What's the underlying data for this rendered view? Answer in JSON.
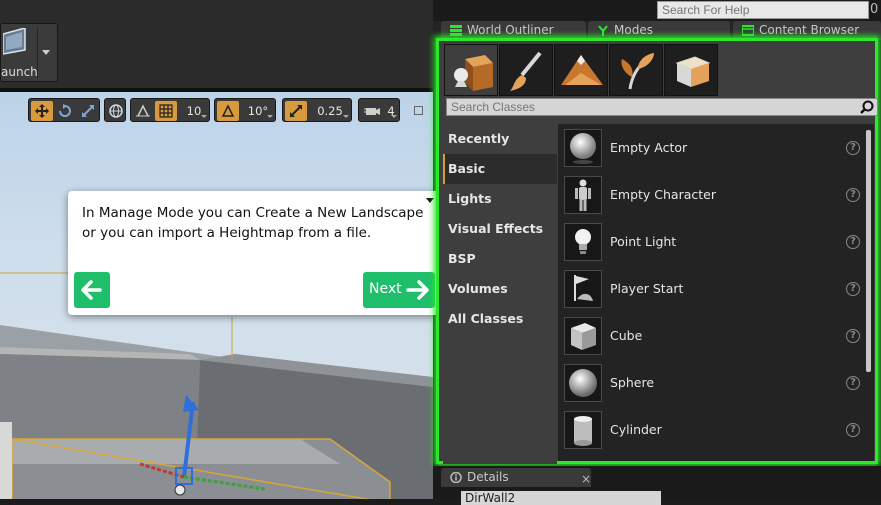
{
  "toolbar": {
    "launch_label": "aunch"
  },
  "viewport_toolbar": {
    "grid_snap": "10",
    "rotation_snap": "10°",
    "scale_snap": "0.25",
    "camera_speed": "4"
  },
  "tutorial": {
    "text": "In Manage Mode you can Create a New Landscape or you can import a Heightmap from a file.",
    "next_label": "Next"
  },
  "help_search": {
    "placeholder": "Search For Help",
    "close_glyph": "0"
  },
  "panel_tabs": [
    {
      "label": "World Outliner"
    },
    {
      "label": "Modes"
    },
    {
      "label": "Content Browser"
    }
  ],
  "modes": {
    "search_placeholder": "Search Classes",
    "categories": [
      {
        "label": "Recently Placed"
      },
      {
        "label": "Basic"
      },
      {
        "label": "Lights"
      },
      {
        "label": "Visual Effects"
      },
      {
        "label": "BSP"
      },
      {
        "label": "Volumes"
      },
      {
        "label": "All Classes"
      }
    ],
    "selected_category": "Basic",
    "items": [
      {
        "label": "Empty Actor",
        "help": "?"
      },
      {
        "label": "Empty Character",
        "help": "?"
      },
      {
        "label": "Point Light",
        "help": "?"
      },
      {
        "label": "Player Start",
        "help": "?"
      },
      {
        "label": "Cube",
        "help": "?"
      },
      {
        "label": "Sphere",
        "help": "?"
      },
      {
        "label": "Cylinder",
        "help": "?"
      }
    ]
  },
  "details": {
    "tab_label": "Details",
    "close_glyph": "×",
    "name_value": "DirWall2"
  },
  "colors": {
    "accent_green": "#2ae82a",
    "button_green": "#1fbe6b",
    "active_orange": "#d79a3c"
  }
}
